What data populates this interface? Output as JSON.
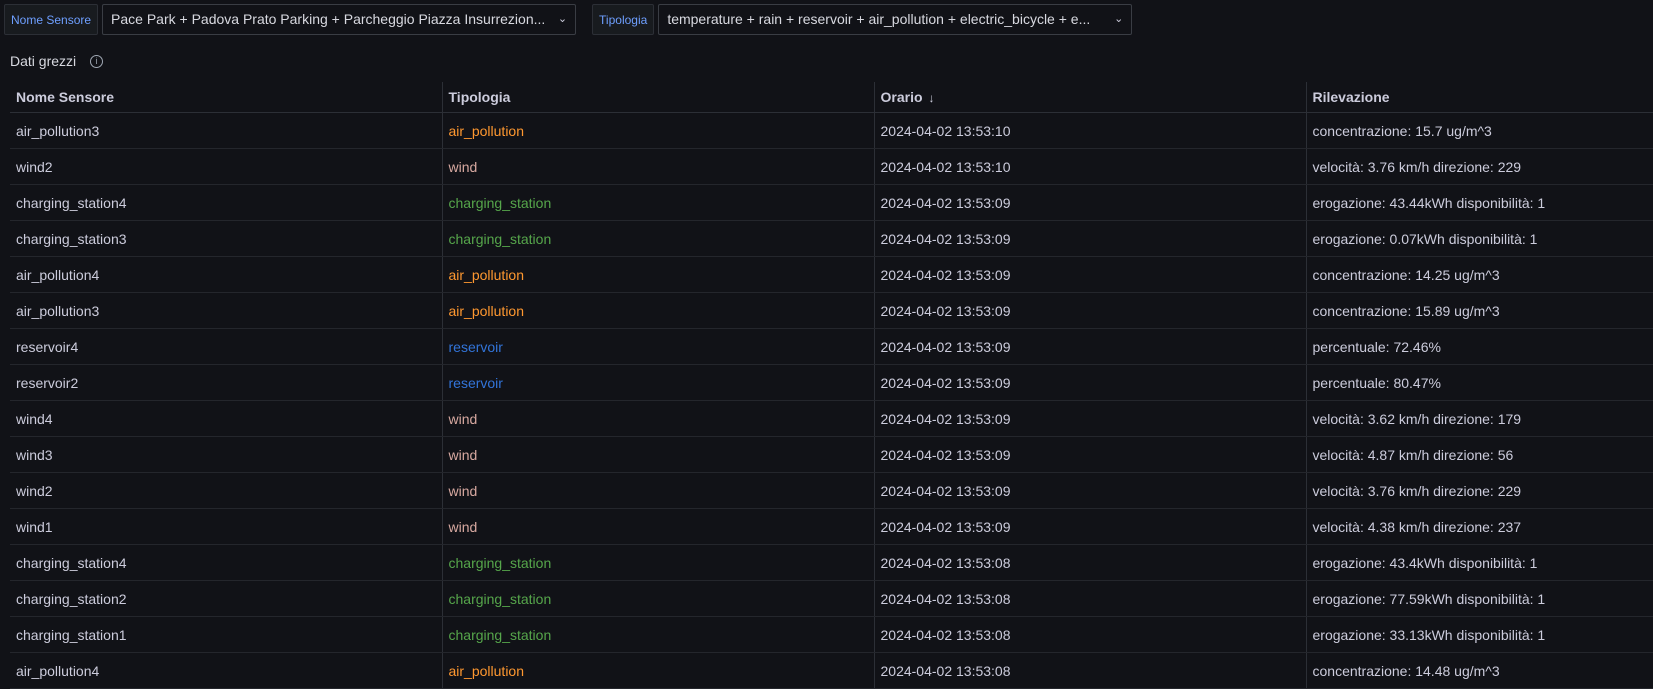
{
  "variables": {
    "sensor": {
      "label": "Nome Sensore",
      "value": "Pace Park + Padova Prato Parking + Parcheggio Piazza Insurrezion..."
    },
    "type": {
      "label": "Tipologia",
      "value": "temperature + rain + reservoir + air_pollution + electric_bicycle + e..."
    }
  },
  "panel": {
    "title": "Dati grezzi"
  },
  "table": {
    "columns": [
      "Nome Sensore",
      "Tipologia",
      "Orario",
      "Rilevazione"
    ],
    "sort": {
      "column": "Orario",
      "direction": "desc",
      "icon": "arrow-down-icon"
    },
    "type_colors": {
      "air_pollution": "#ff9830",
      "wind": "#d8a9a1",
      "charging_station": "#56a64b",
      "reservoir": "#3274d9"
    },
    "rows": [
      {
        "sensor": "air_pollution3",
        "type": "air_pollution",
        "time": "2024-04-02 13:53:10",
        "reading": "concentrazione: 15.7 ug/m^3"
      },
      {
        "sensor": "wind2",
        "type": "wind",
        "time": "2024-04-02 13:53:10",
        "reading": "velocità: 3.76 km/h direzione: 229"
      },
      {
        "sensor": "charging_station4",
        "type": "charging_station",
        "time": "2024-04-02 13:53:09",
        "reading": "erogazione: 43.44kWh disponibilità: 1"
      },
      {
        "sensor": "charging_station3",
        "type": "charging_station",
        "time": "2024-04-02 13:53:09",
        "reading": "erogazione: 0.07kWh disponibilità: 1"
      },
      {
        "sensor": "air_pollution4",
        "type": "air_pollution",
        "time": "2024-04-02 13:53:09",
        "reading": "concentrazione: 14.25 ug/m^3"
      },
      {
        "sensor": "air_pollution3",
        "type": "air_pollution",
        "time": "2024-04-02 13:53:09",
        "reading": "concentrazione: 15.89 ug/m^3"
      },
      {
        "sensor": "reservoir4",
        "type": "reservoir",
        "time": "2024-04-02 13:53:09",
        "reading": "percentuale: 72.46%"
      },
      {
        "sensor": "reservoir2",
        "type": "reservoir",
        "time": "2024-04-02 13:53:09",
        "reading": "percentuale: 80.47%"
      },
      {
        "sensor": "wind4",
        "type": "wind",
        "time": "2024-04-02 13:53:09",
        "reading": "velocità: 3.62 km/h direzione: 179"
      },
      {
        "sensor": "wind3",
        "type": "wind",
        "time": "2024-04-02 13:53:09",
        "reading": "velocità: 4.87 km/h direzione: 56"
      },
      {
        "sensor": "wind2",
        "type": "wind",
        "time": "2024-04-02 13:53:09",
        "reading": "velocità: 3.76 km/h direzione: 229"
      },
      {
        "sensor": "wind1",
        "type": "wind",
        "time": "2024-04-02 13:53:09",
        "reading": "velocità: 4.38 km/h direzione: 237"
      },
      {
        "sensor": "charging_station4",
        "type": "charging_station",
        "time": "2024-04-02 13:53:08",
        "reading": "erogazione: 43.4kWh disponibilità: 1"
      },
      {
        "sensor": "charging_station2",
        "type": "charging_station",
        "time": "2024-04-02 13:53:08",
        "reading": "erogazione: 77.59kWh disponibilità: 1"
      },
      {
        "sensor": "charging_station1",
        "type": "charging_station",
        "time": "2024-04-02 13:53:08",
        "reading": "erogazione: 33.13kWh disponibilità: 1"
      },
      {
        "sensor": "air_pollution4",
        "type": "air_pollution",
        "time": "2024-04-02 13:53:08",
        "reading": "concentrazione: 14.48 ug/m^3"
      }
    ]
  }
}
